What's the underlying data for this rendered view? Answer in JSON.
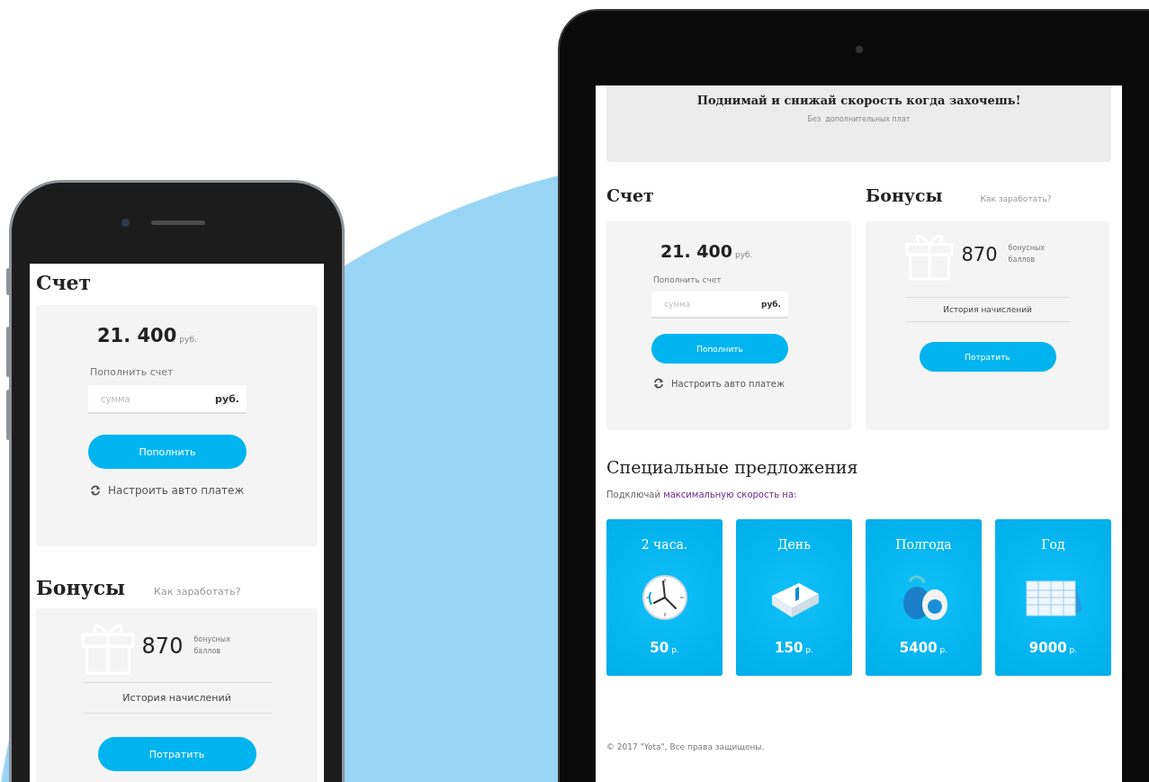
{
  "phone": {
    "account": {
      "heading": "Счет",
      "balance": "21. 400",
      "balance_currency": "руб.",
      "topup_label": "Пополнить счет",
      "amount_field": {
        "placeholder": "сумма",
        "suffix": "руб."
      },
      "topup_button": "Пополнить",
      "autopay_link": "Настроить авто платеж"
    },
    "bonuses": {
      "heading": "Бонусы",
      "help_link": "Как заработать?",
      "points": "870",
      "points_label": "бонусных баллов",
      "history_link": "История начислений",
      "spend_button": "Потратить"
    }
  },
  "tablet": {
    "banner": {
      "title": "Поднимай и снижай скорость когда захочешь!",
      "subtitle": "Без  дополнительных плат"
    },
    "account": {
      "heading": "Счет",
      "balance": "21. 400",
      "balance_currency": "руб.",
      "topup_label": "Пополнить счет",
      "amount_field": {
        "placeholder": "сумма",
        "suffix": "руб."
      },
      "topup_button": "Пополнить",
      "autopay_link": "Настроить авто платеж"
    },
    "bonuses": {
      "heading": "Бонусы",
      "help_link": "Как заработать?",
      "points": "870",
      "points_label": "бонусных баллов",
      "history_link": "История начислений",
      "spend_button": "Потратить"
    },
    "offers": {
      "heading": "Специальные предложения",
      "intro_text": "Подключай",
      "intro_link": "максимальную скорость на:",
      "tiles": [
        {
          "kind": "clock",
          "title": "2 часа.",
          "price": "50",
          "currency": "р."
        },
        {
          "kind": "tear-calendar",
          "title": "День",
          "price": "150",
          "currency": "р."
        },
        {
          "kind": "avocado",
          "title": "Полгода",
          "price": "5400",
          "currency": "р."
        },
        {
          "kind": "desk-calendar",
          "title": "Год",
          "price": "9000",
          "currency": "р."
        }
      ]
    },
    "footer": "© 2017 \"Yota\", Все права защищены."
  }
}
